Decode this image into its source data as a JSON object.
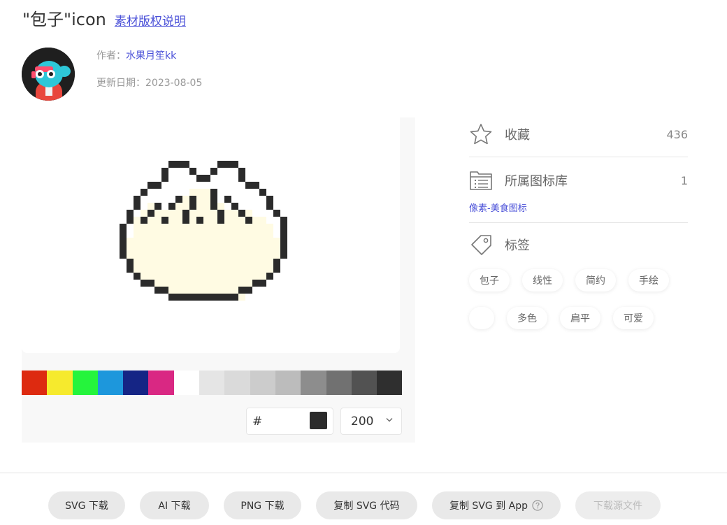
{
  "header": {
    "title": "\"包子\"icon",
    "license_link": "素材版权说明"
  },
  "meta": {
    "author_prefix": "作者：",
    "author_name": "水果月笙kk",
    "date_prefix": "更新日期：",
    "date_value": "2023-08-05"
  },
  "editor": {
    "palette": [
      "#dd2a10",
      "#f6ea2d",
      "#25f43c",
      "#1d97dc",
      "#152585",
      "#d92883",
      "#ffffff",
      "#e5e5e5",
      "#dadada",
      "#cccccc",
      "#bcbcbc",
      "#8d8d8d",
      "#717171",
      "#525252",
      "#2f2f2f"
    ],
    "hex_prefix": "#",
    "current_color": "#2b2b2b",
    "size_value": "200"
  },
  "sidebar": {
    "favorite_label": "收藏",
    "favorite_count": "436",
    "library_label": "所属图标库",
    "library_count": "1",
    "library_name": "像素-美食图标",
    "tags_label": "标签",
    "tags": [
      "包子",
      "线性",
      "简约",
      "手绘",
      "",
      "多色",
      "扁平",
      "可爱"
    ]
  },
  "actions": {
    "svg_download": "SVG 下载",
    "ai_download": "AI 下载",
    "png_download": "PNG 下载",
    "copy_svg_code": "复制 SVG 代码",
    "copy_svg_to_app": "复制 SVG 到 App",
    "download_source": "下载源文件"
  }
}
